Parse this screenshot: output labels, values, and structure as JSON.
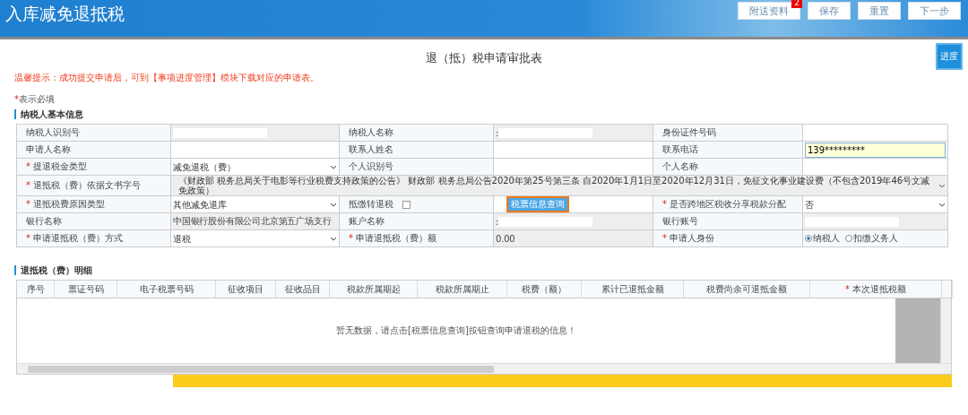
{
  "header": {
    "title": "入库减免退抵税",
    "buttons": [
      {
        "label": "附送资料",
        "badge": "2"
      },
      {
        "label": "保存"
      },
      {
        "label": "重置"
      },
      {
        "label": "下一步"
      }
    ]
  },
  "progress_button": "进度",
  "form_title": "退（抵）税申请审批表",
  "notice": "温馨提示：成功提交申请后，可到【事项进度管理】模块下载对应的申请表。",
  "required_note": {
    "mark": "*",
    "text": "表示必填"
  },
  "basic_section": "纳税人基本信息",
  "form_rows": [
    [
      {
        "kind": "label",
        "text": "纳税人识别号",
        "required": false
      },
      {
        "kind": "masked"
      },
      {
        "kind": "label",
        "text": "纳税人名称",
        "required": false
      },
      {
        "kind": "masked",
        "prefix": ":"
      },
      {
        "kind": "label",
        "text": "身份证件号码",
        "required": false
      },
      {
        "kind": "empty"
      }
    ],
    [
      {
        "kind": "label",
        "text": "申请人名称",
        "required": false
      },
      {
        "kind": "empty"
      },
      {
        "kind": "label",
        "text": "联系人姓名",
        "required": false
      },
      {
        "kind": "empty"
      },
      {
        "kind": "label",
        "text": "联系电话",
        "required": false
      },
      {
        "kind": "input",
        "value": "139*********"
      }
    ],
    [
      {
        "kind": "label",
        "text": "提退税金类型",
        "required": true
      },
      {
        "kind": "select",
        "value": "减免退税（费）"
      },
      {
        "kind": "label",
        "text": "个人识别号",
        "required": false
      },
      {
        "kind": "empty"
      },
      {
        "kind": "label",
        "text": "个人名称",
        "required": false
      },
      {
        "kind": "empty"
      }
    ],
    [
      {
        "kind": "label",
        "text": "退抵税（费）依据文书字号",
        "required": true
      },
      {
        "kind": "wide-select",
        "value": "《财政部 税务总局关于电影等行业税费支持政策的公告》 财政部 税务总局公告2020年第25号第三条 自2020年1月1日至2020年12月31日，免征文化事业建设费（不包含2019年46号文减免政策）"
      }
    ],
    [
      {
        "kind": "label",
        "text": "退抵税费原因类型",
        "required": true
      },
      {
        "kind": "select",
        "value": "其他减免退库"
      },
      {
        "kind": "checkbox-label",
        "text": "抵缴转退税",
        "checked": false
      },
      {
        "kind": "button",
        "label": "税票信息查询"
      },
      {
        "kind": "label",
        "text": "是否跨地区税收分享税款分配",
        "required": true
      },
      {
        "kind": "select",
        "value": "否"
      }
    ],
    [
      {
        "kind": "label",
        "text": "银行名称",
        "required": false
      },
      {
        "kind": "text",
        "value": "中国银行股份有限公司北京第五广场支行"
      },
      {
        "kind": "label",
        "text": "账户名称",
        "required": false
      },
      {
        "kind": "masked",
        "prefix": ":"
      },
      {
        "kind": "label",
        "text": "银行账号",
        "required": false
      },
      {
        "kind": "masked"
      }
    ],
    [
      {
        "kind": "label",
        "text": "申请退抵税（费）方式",
        "required": true
      },
      {
        "kind": "select",
        "value": "退税"
      },
      {
        "kind": "label",
        "text": "申请退抵税（费）额",
        "required": true
      },
      {
        "kind": "text",
        "value": "0.00"
      },
      {
        "kind": "label",
        "text": "申请人身份",
        "required": true
      },
      {
        "kind": "radios",
        "options": [
          {
            "label": "纳税人",
            "selected": true
          },
          {
            "label": "扣缴义务人",
            "selected": false
          }
        ]
      }
    ]
  ],
  "detail_section": "退抵税（费）明细",
  "detail_table": {
    "columns": [
      {
        "label": "序号",
        "required": false
      },
      {
        "label": "票证号码",
        "required": false
      },
      {
        "label": "电子税票号码",
        "required": false
      },
      {
        "label": "征收项目",
        "required": false
      },
      {
        "label": "征收品目",
        "required": false
      },
      {
        "label": "税款所属期起",
        "required": false
      },
      {
        "label": "税款所属期止",
        "required": false
      },
      {
        "label": "税费（额）",
        "required": false
      },
      {
        "label": "累计已退抵金额",
        "required": false
      },
      {
        "label": "税费尚余可退抵金额",
        "required": false
      },
      {
        "label": "本次退抵税额",
        "required": true
      }
    ],
    "empty_message": "暂无数据，请点击[税票信息查询]按钮查询申请退税的信息！"
  }
}
